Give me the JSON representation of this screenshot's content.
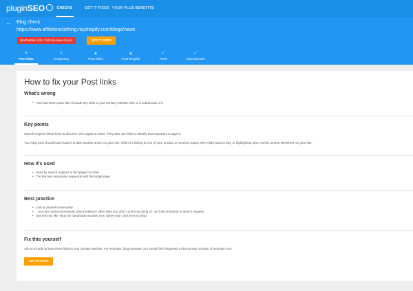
{
  "app": {
    "logo_part1": "plugin",
    "logo_part2": "SEO"
  },
  "nav": {
    "items": [
      {
        "label": "CHECKS"
      },
      {
        "label": "GET IT FIXED"
      },
      {
        "label": "YOUR PLUS BENEFITS"
      }
    ]
  },
  "header": {
    "title": "Blog check",
    "url": "https://www.afflictionclothing.myshopify.com/blogs/news",
    "critical_badge": "Worthwhile to fix: Critical issues found.",
    "fix_button": "GET IT FIXED"
  },
  "tabs": [
    {
      "label": "Post links",
      "icon": "×"
    },
    {
      "label": "Frequency",
      "icon": "×"
    },
    {
      "label": "Post titles",
      "icon": "▲"
    },
    {
      "label": "Post lengths",
      "icon": "▲"
    },
    {
      "label": "Feed",
      "icon": "✓"
    },
    {
      "label": "Own domain",
      "icon": "✓"
    }
  ],
  "content": {
    "title": "How to fix your Post links",
    "whats_wrong": {
      "heading": "What's wrong",
      "items": [
        "Your last three posts don't include any links to your primary website URL or a subdomain of it."
      ]
    },
    "key_points": {
      "heading": "Key points",
      "p1": "Search engines follow links to discover new pages to index. They also use links to identify how important a page is.",
      "p2": "Your blog post should lead readers to take another action on your site. Often it's linking to one of your product or services pages they might want to buy, or highlighting other useful content elsewhere on your site."
    },
    "how_used": {
      "heading": "How it's used",
      "items": [
        "Used by search engines to find pages to index",
        "The link text associates keywords with the target page"
      ]
    },
    "best_practice": {
      "heading": "Best practice",
      "items": [
        "Link to yourself extensively",
        "...but don't worry excessively about linking to other sites you don't control as doing so can look unnatural to search engines",
        "Use link text like 'shop for handmade wooden toys' rather than 'click here to shop'"
      ]
    },
    "fix_yourself": {
      "heading": "Fix this yourself",
      "text": "Aim to include at least three links to your primary website. For example, blog.example.com should link frequently to the primary domain of example.com.",
      "button": "GET IT FIXED"
    }
  },
  "colors": {
    "topbar": "#1a8fe6",
    "header": "#2196f3",
    "critical": "#e53935",
    "accent": "#ffa000"
  }
}
